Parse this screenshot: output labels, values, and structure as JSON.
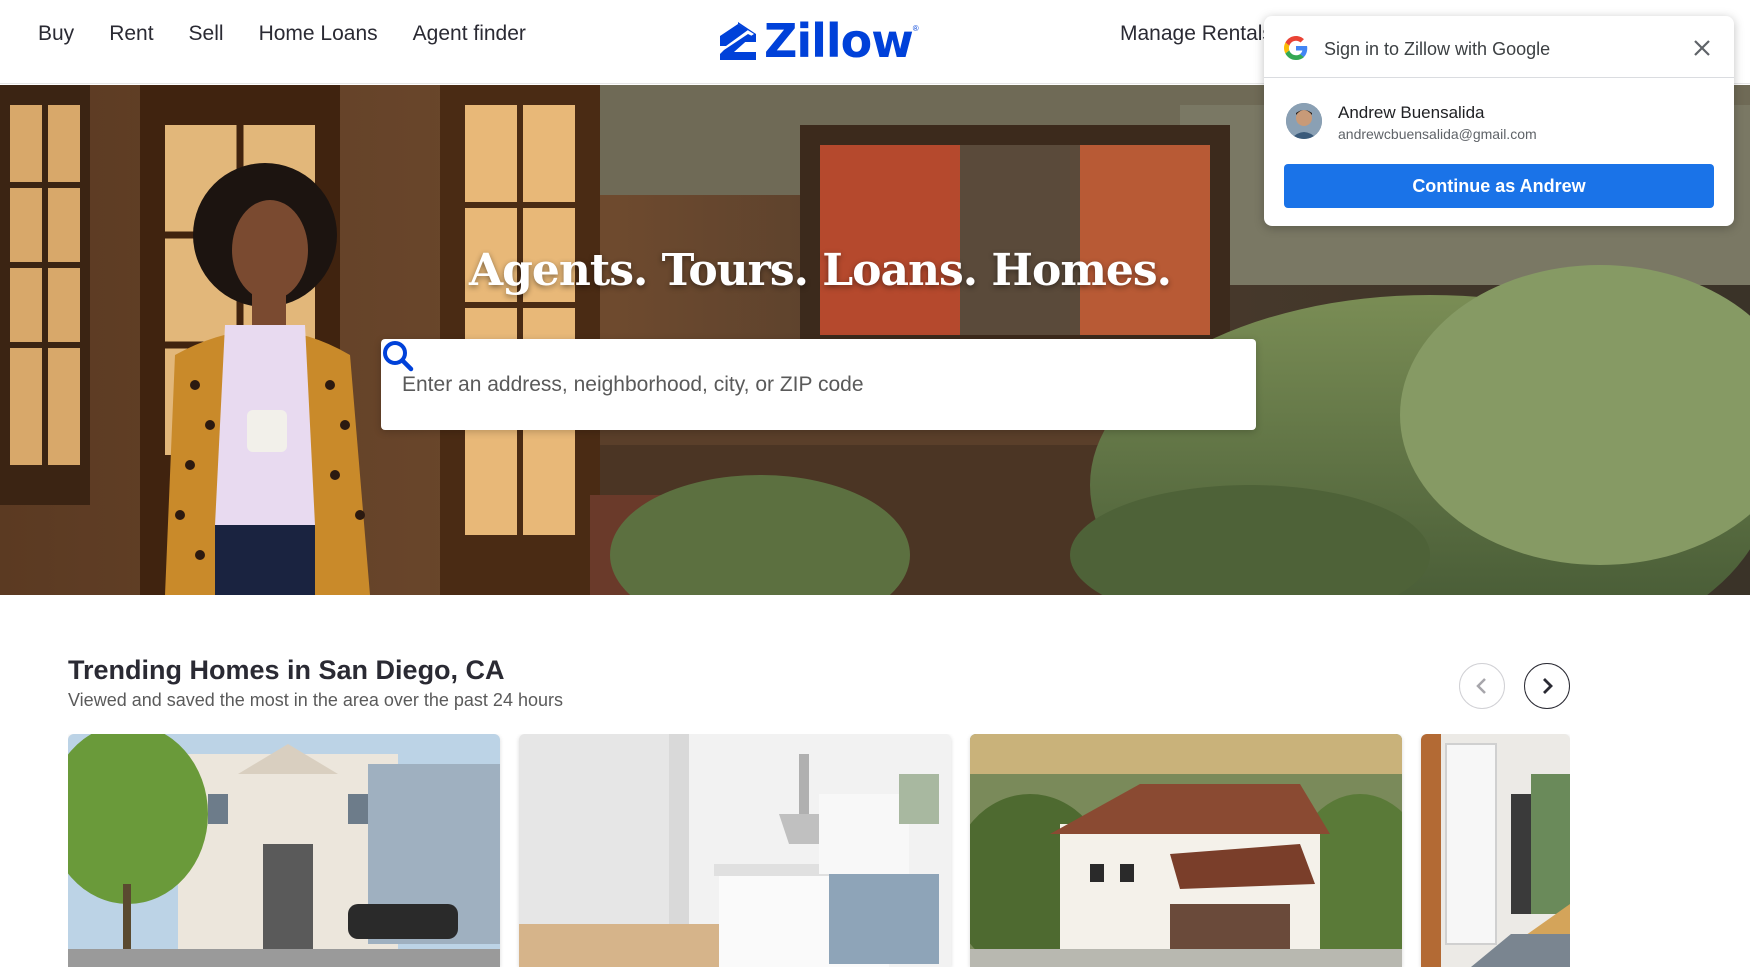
{
  "header": {
    "nav_left": [
      "Buy",
      "Rent",
      "Sell",
      "Home Loans",
      "Agent finder"
    ],
    "logo_text": "Zillow",
    "logo_reg": "®",
    "nav_right": "Manage Rentals"
  },
  "hero": {
    "title": "Agents. Tours. Loans. Homes.",
    "search_placeholder": "Enter an address, neighborhood, city, or ZIP code",
    "search_value": ""
  },
  "trending": {
    "title": "Trending Homes in San Diego, CA",
    "subtitle": "Viewed and saved the most in the area over the past 24 hours"
  },
  "google_popup": {
    "title": "Sign in to Zillow with Google",
    "account_name": "Andrew Buensalida",
    "account_email": "andrewcbuensalida@gmail.com",
    "continue_label": "Continue as Andrew"
  },
  "colors": {
    "zillow_blue": "#0041d9",
    "google_blue": "#1a73e8",
    "text_dark": "#2a2a33"
  }
}
